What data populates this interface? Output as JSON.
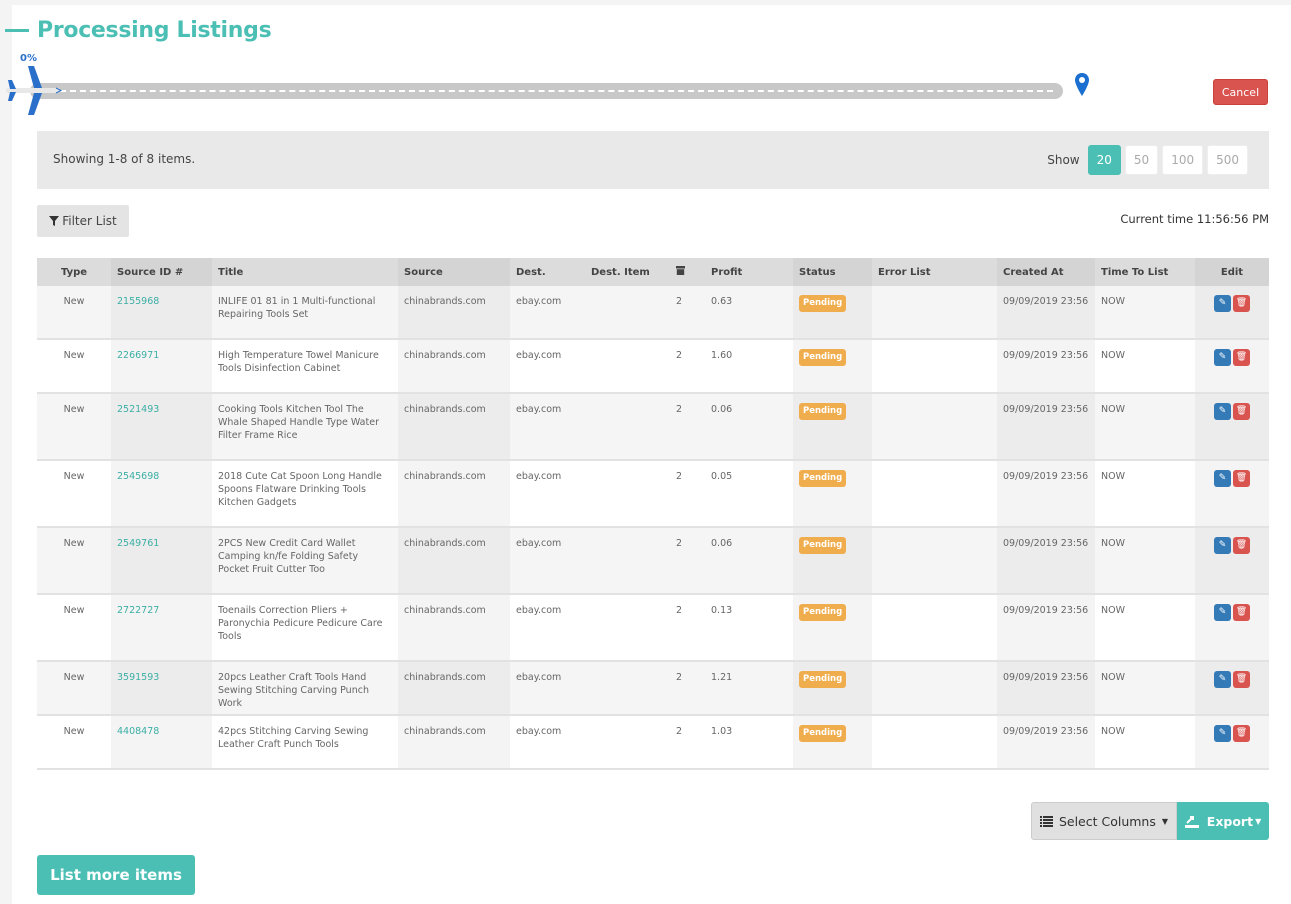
{
  "page_title": "Processing Listings",
  "progress": {
    "label": "0%",
    "value": 0
  },
  "cancel_label": "Cancel",
  "summary": "Showing 1-8 of 8 items.",
  "page_size": {
    "label": "Show",
    "options": [
      "20",
      "50",
      "100",
      "500"
    ],
    "selected": "20"
  },
  "filter_label": "Filter List",
  "current_time": "Current time 11:56:56 PM",
  "table": {
    "columns": [
      "Type",
      "Source ID #",
      "Title",
      "Source",
      "Dest.",
      "Dest. Item",
      "archive-icon",
      "Profit",
      "Status",
      "Error List",
      "Created At",
      "Time To List",
      "Edit"
    ],
    "rows": [
      {
        "type": "New",
        "source_id": "2155968",
        "title": "INLIFE 01 81 in 1 Multi-functional Repairing Tools Set",
        "source": "chinabrands.com",
        "dest": "ebay.com",
        "dest_item": "",
        "qty": "2",
        "profit": "0.63",
        "status": "Pending",
        "error": "",
        "created": "09/09/2019 23:56",
        "time_to_list": "NOW"
      },
      {
        "type": "New",
        "source_id": "2266971",
        "title": "High Temperature Towel Manicure Tools Disinfection Cabinet",
        "source": "chinabrands.com",
        "dest": "ebay.com",
        "dest_item": "",
        "qty": "2",
        "profit": "1.60",
        "status": "Pending",
        "error": "",
        "created": "09/09/2019 23:56",
        "time_to_list": "NOW"
      },
      {
        "type": "New",
        "source_id": "2521493",
        "title": "Cooking Tools Kitchen Tool The Whale Shaped Handle Type Water Filter Frame Rice",
        "source": "chinabrands.com",
        "dest": "ebay.com",
        "dest_item": "",
        "qty": "2",
        "profit": "0.06",
        "status": "Pending",
        "error": "",
        "created": "09/09/2019 23:56",
        "time_to_list": "NOW"
      },
      {
        "type": "New",
        "source_id": "2545698",
        "title": "2018 Cute Cat Spoon Long Handle Spoons Flatware Drinking Tools Kitchen Gadgets",
        "source": "chinabrands.com",
        "dest": "ebay.com",
        "dest_item": "",
        "qty": "2",
        "profit": "0.05",
        "status": "Pending",
        "error": "",
        "created": "09/09/2019 23:56",
        "time_to_list": "NOW"
      },
      {
        "type": "New",
        "source_id": "2549761",
        "title": "2PCS New Credit Card Wallet Camping kn/fe Folding Safety Pocket Fruit Cutter Too",
        "source": "chinabrands.com",
        "dest": "ebay.com",
        "dest_item": "",
        "qty": "2",
        "profit": "0.06",
        "status": "Pending",
        "error": "",
        "created": "09/09/2019 23:56",
        "time_to_list": "NOW"
      },
      {
        "type": "New",
        "source_id": "2722727",
        "title": "Toenails Correction Pliers + Paronychia Pedicure Pedicure Care Tools",
        "source": "chinabrands.com",
        "dest": "ebay.com",
        "dest_item": "",
        "qty": "2",
        "profit": "0.13",
        "status": "Pending",
        "error": "",
        "created": "09/09/2019 23:56",
        "time_to_list": "NOW"
      },
      {
        "type": "New",
        "source_id": "3591593",
        "title": "20pcs Leather Craft Tools Hand Sewing Stitching Carving Punch Work",
        "source": "chinabrands.com",
        "dest": "ebay.com",
        "dest_item": "",
        "qty": "2",
        "profit": "1.21",
        "status": "Pending",
        "error": "",
        "created": "09/09/2019 23:56",
        "time_to_list": "NOW"
      },
      {
        "type": "New",
        "source_id": "4408478",
        "title": "42pcs Stitching Carving Sewing Leather Craft Punch Tools",
        "source": "chinabrands.com",
        "dest": "ebay.com",
        "dest_item": "",
        "qty": "2",
        "profit": "1.03",
        "status": "Pending",
        "error": "",
        "created": "09/09/2019 23:56",
        "time_to_list": "NOW"
      }
    ]
  },
  "select_columns_label": "Select Columns",
  "export_label": "Export",
  "list_more_label": "List more items",
  "colors": {
    "accent": "#4bbfb4",
    "danger": "#d9534f",
    "primary": "#337ab7",
    "warning": "#f0ad4e",
    "plane": "#2a6fc9"
  }
}
